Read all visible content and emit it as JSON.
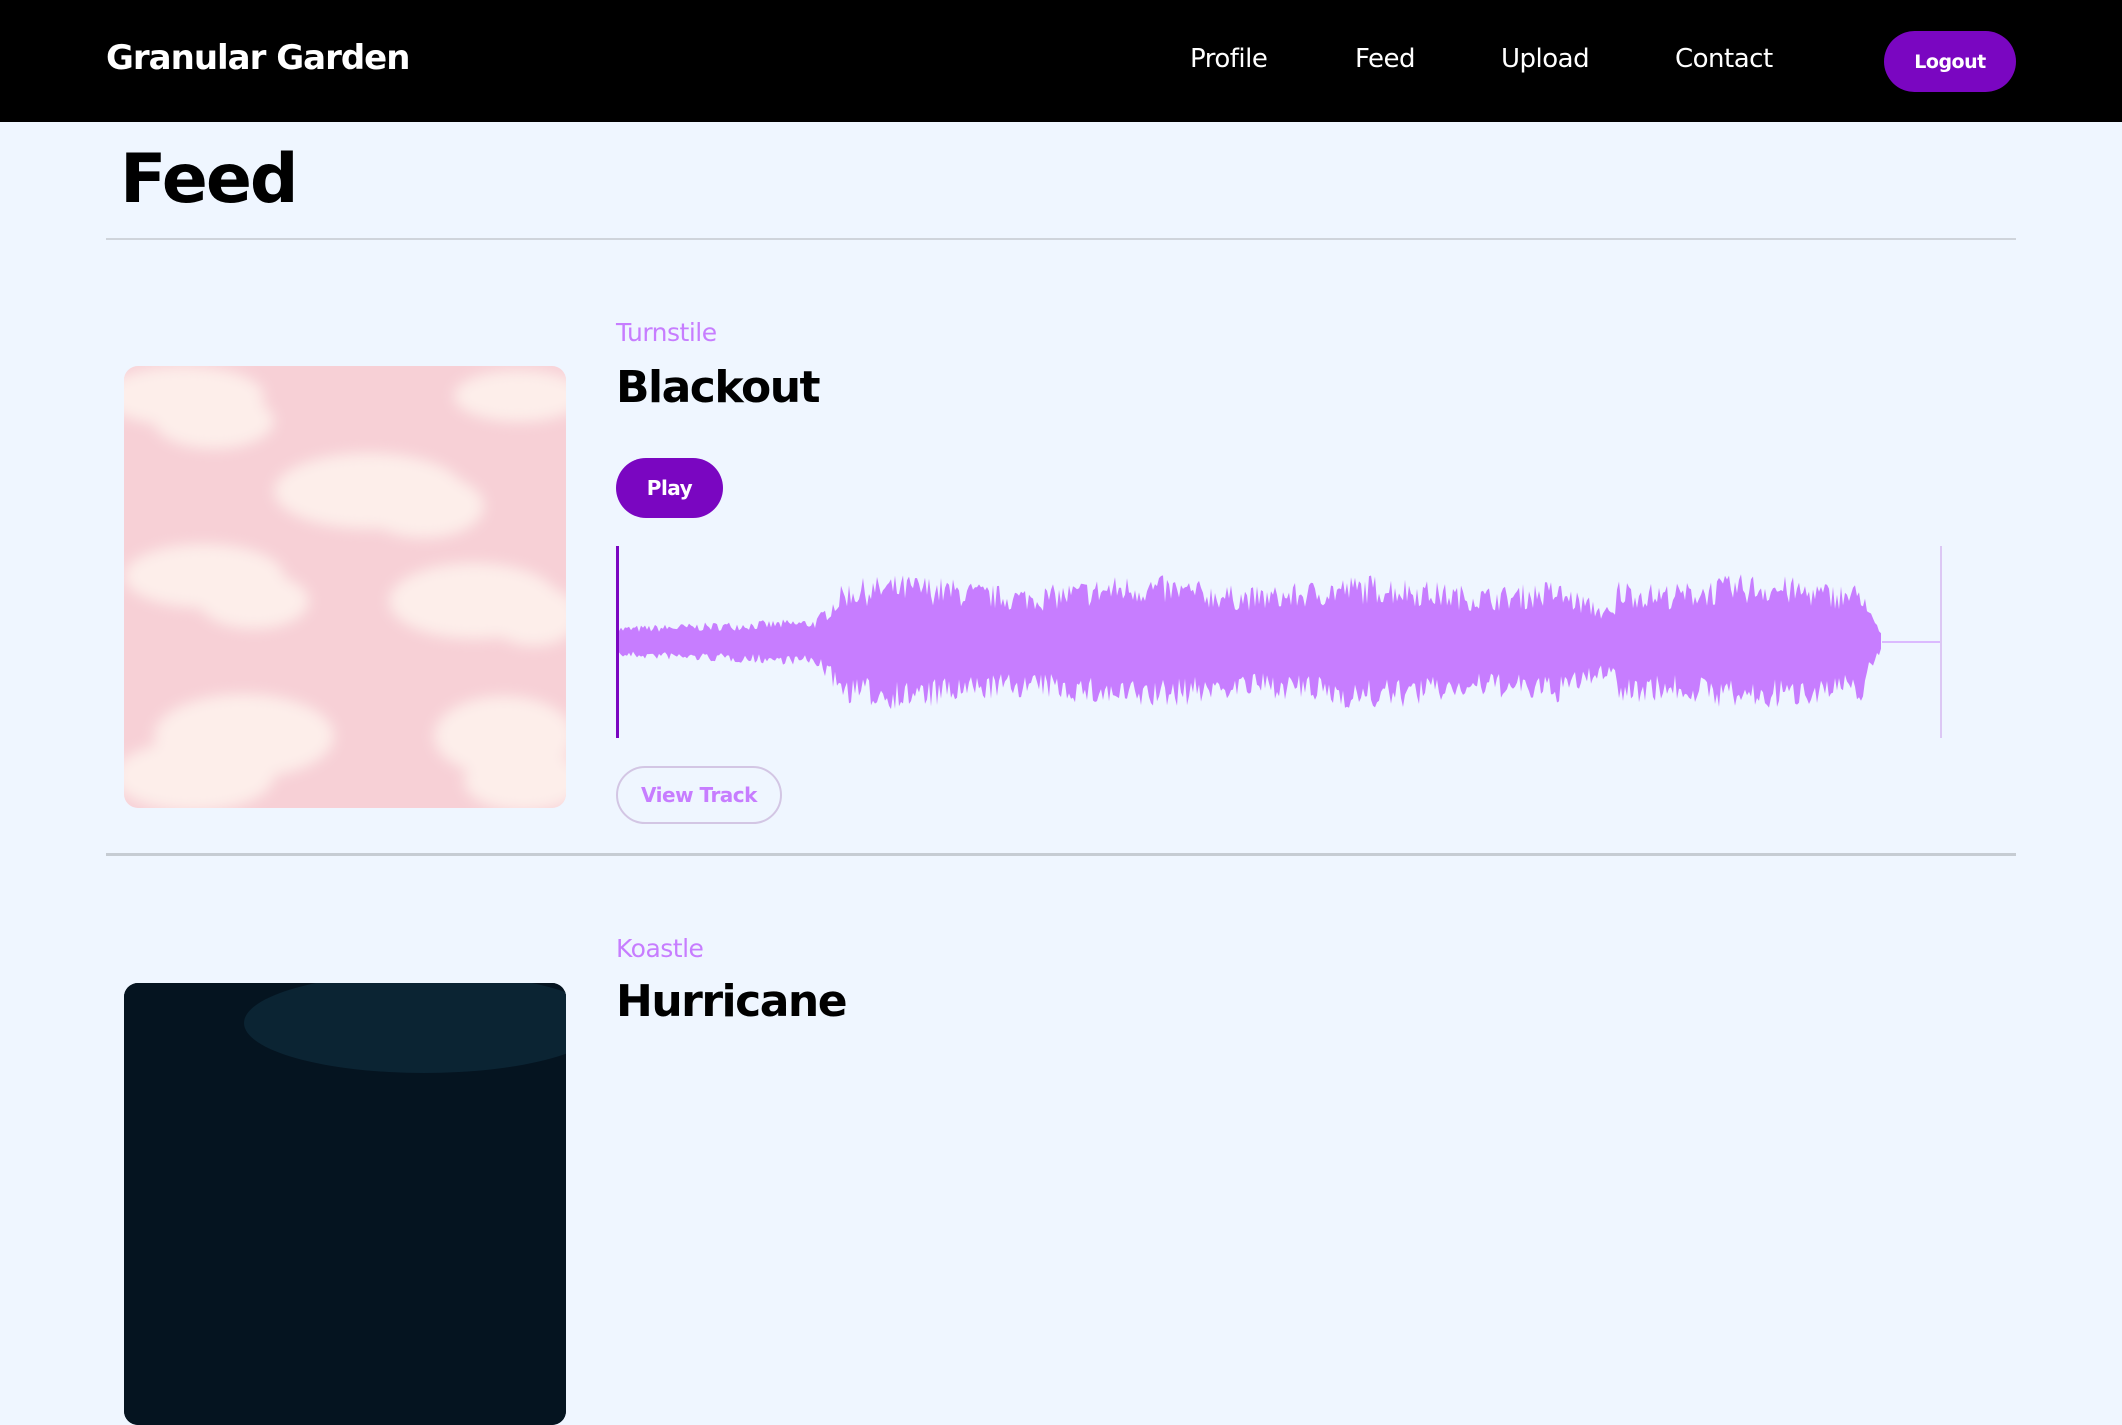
{
  "app": {
    "brand": "Granular Garden"
  },
  "nav": {
    "items": [
      {
        "label": "Profile"
      },
      {
        "label": "Feed"
      },
      {
        "label": "Upload"
      },
      {
        "label": "Contact"
      }
    ],
    "logout_label": "Logout"
  },
  "page": {
    "title": "Feed"
  },
  "feed": {
    "tracks": [
      {
        "artist": "Turnstile",
        "title": "Blackout",
        "play_label": "Play",
        "view_label": "View Track",
        "cover_icon": "pink-clouds-artwork",
        "playback_progress": 0
      },
      {
        "artist": "Koastle",
        "title": "Hurricane",
        "cover_icon": "dark-artwork"
      }
    ]
  },
  "colors": {
    "accent": "#7a06c1",
    "artist_text": "#c77dff",
    "waveform": "#c77dff",
    "waveform_progress": "#7a06c1",
    "background": "#eff6ff",
    "navbar": "#000000"
  }
}
